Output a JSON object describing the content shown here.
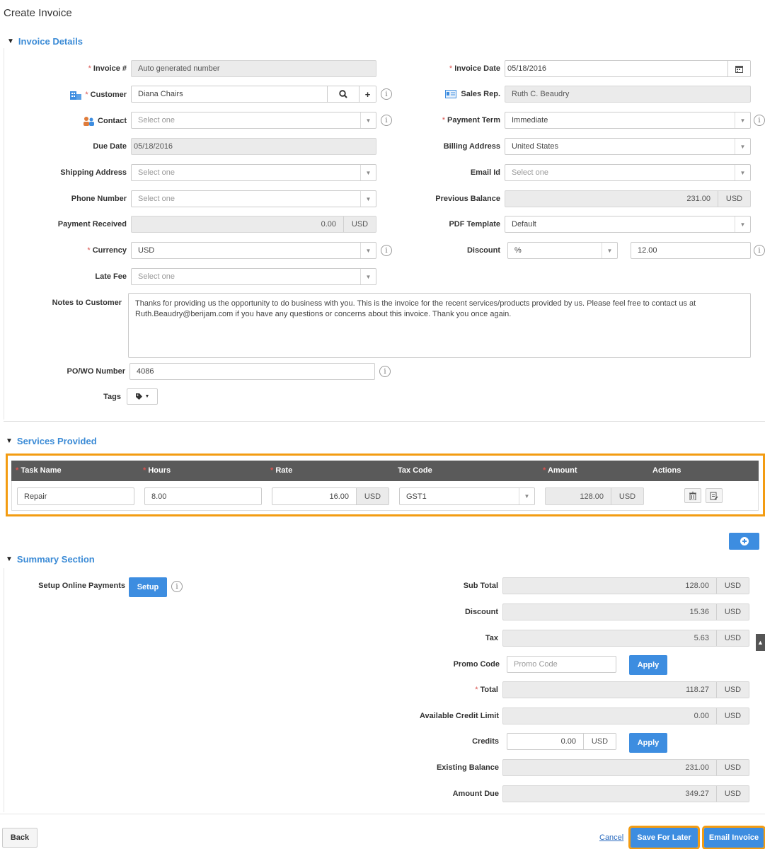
{
  "page": {
    "title": "Create Invoice"
  },
  "sections": {
    "invoice_details": "Invoice Details",
    "services_provided": "Services Provided",
    "summary": "Summary Section"
  },
  "invoice": {
    "invoice_no_label": "Invoice #",
    "invoice_no_placeholder": "Auto generated number",
    "customer_label": "Customer",
    "customer_value": "Diana Chairs",
    "contact_label": "Contact",
    "contact_value": "Select one",
    "due_date_label": "Due Date",
    "due_date_value": "05/18/2016",
    "shipping_label": "Shipping Address",
    "shipping_value": "Select one",
    "phone_label": "Phone Number",
    "phone_value": "Select one",
    "payment_received_label": "Payment Received",
    "payment_received_value": "0.00",
    "payment_received_unit": "USD",
    "currency_label": "Currency",
    "currency_value": "USD",
    "late_fee_label": "Late Fee",
    "late_fee_value": "Select one",
    "invoice_date_label": "Invoice Date",
    "invoice_date_value": "05/18/2016",
    "sales_rep_label": "Sales Rep.",
    "sales_rep_value": "Ruth C. Beaudry",
    "payment_term_label": "Payment Term",
    "payment_term_value": "Immediate",
    "billing_label": "Billing Address",
    "billing_value": "United States",
    "email_label": "Email Id",
    "email_value": "Select one",
    "prev_balance_label": "Previous Balance",
    "prev_balance_value": "231.00",
    "prev_balance_unit": "USD",
    "pdf_label": "PDF Template",
    "pdf_value": "Default",
    "discount_label": "Discount",
    "discount_type": "%",
    "discount_value": "12.00",
    "notes_label": "Notes to Customer",
    "notes_value": "Thanks for providing us the opportunity to do business with you. This is the invoice for the recent services/products provided by us. Please feel free to contact us at Ruth.Beaudry@berijam.com if you have any questions or concerns about this invoice. Thank you once again.",
    "po_label": "PO/WO Number",
    "po_value": "4086",
    "tags_label": "Tags"
  },
  "services": {
    "headers": [
      "Task Name",
      "Hours",
      "Rate",
      "Tax Code",
      "Amount",
      "Actions"
    ],
    "row": {
      "task": "Repair",
      "hours": "8.00",
      "rate": "16.00",
      "rate_unit": "USD",
      "tax_code": "GST1",
      "amount": "128.00",
      "amount_unit": "USD"
    }
  },
  "summary": {
    "setup_label": "Setup Online Payments",
    "setup_button": "Setup",
    "sub_total_label": "Sub Total",
    "sub_total_value": "128.00",
    "discount_label": "Discount",
    "discount_value": "15.36",
    "tax_label": "Tax",
    "tax_value": "5.63",
    "promo_label": "Promo Code",
    "promo_placeholder": "Promo Code",
    "apply_label": "Apply",
    "total_label": "Total",
    "total_value": "118.27",
    "credit_limit_label": "Available Credit Limit",
    "credit_limit_value": "0.00",
    "credits_label": "Credits",
    "credits_value": "0.00",
    "existing_label": "Existing Balance",
    "existing_value": "231.00",
    "amount_due_label": "Amount Due",
    "amount_due_value": "349.27",
    "unit": "USD"
  },
  "footer": {
    "back": "Back",
    "cancel": "Cancel",
    "save_later": "Save For Later",
    "email_invoice": "Email Invoice"
  },
  "colors": {
    "accent": "#3d8de0",
    "highlight": "#f39c12",
    "grid_header": "#5a5a5a"
  }
}
